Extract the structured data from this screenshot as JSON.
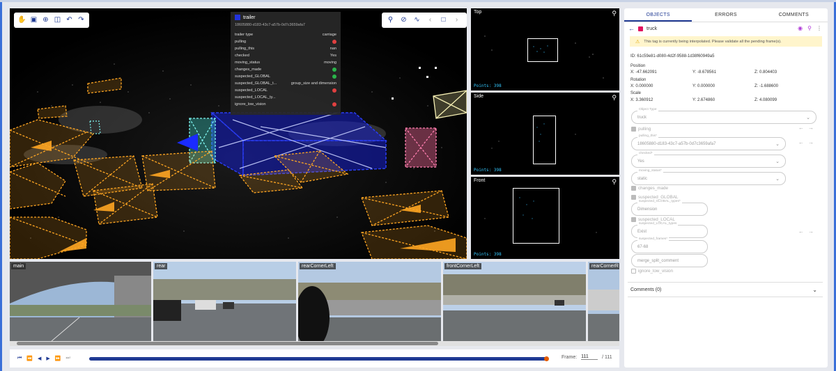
{
  "main_view": {
    "info_panel": {
      "title": "trailer",
      "uid": "18605880-d183-43c7-a57b-0d7c3659afa7",
      "rows": [
        {
          "label": "trailer type",
          "value": "carriage"
        },
        {
          "label": "pulling",
          "value": "no"
        },
        {
          "label": "pulling_this",
          "value": "nan"
        },
        {
          "label": "checked",
          "value": "Yes"
        },
        {
          "label": "moving_status",
          "value": "moving"
        },
        {
          "label": "changes_made",
          "value": "yes"
        },
        {
          "label": "suspected_GLOBAL",
          "value": "yes"
        },
        {
          "label": "suspected_GLOBAL_t...",
          "value": "group_size and dimension"
        },
        {
          "label": "suspected_LOCAL",
          "value": "no"
        },
        {
          "label": "suspected_LOCAL_ty...",
          "value": ""
        },
        {
          "label": "ignore_low_vision",
          "value": "no"
        }
      ]
    }
  },
  "side_views": [
    {
      "label": "Top",
      "points": "Points: 398"
    },
    {
      "label": "Side",
      "points": "Points: 398"
    },
    {
      "label": "Front",
      "points": "Points: 398"
    }
  ],
  "cameras": [
    "main",
    "rear",
    "rearCornerLeft",
    "frontCornerLeft",
    "rearCornerR"
  ],
  "player": {
    "frame_label": "Frame:",
    "frame_value": "111",
    "frame_total": "/ 111",
    "progress": 0.99
  },
  "panel": {
    "tabs": [
      "OBJECTS",
      "ERRORS",
      "COMMENTS"
    ],
    "active_tab": "OBJECTS",
    "object_name": "truck",
    "object_color": "#e0115f",
    "warning": "This tag is currently being interpolated. Please validate all the pending frame(s).",
    "id_line": "ID: 61c59e81-d080-4d2f-9588-1d38f60949a5",
    "position_label": "Position",
    "position": [
      "X: -47.662091",
      "Y: -8.678561",
      "Z: 0.804403"
    ],
    "rotation_label": "Rotation",
    "rotation": [
      "X: 0.000000",
      "Y: 0.000000",
      "Z: -1.688600"
    ],
    "scale_label": "Scale",
    "scale": [
      "X: 3.360912",
      "Y: 2.674860",
      "Z: 4.080099"
    ],
    "object_type_label": "Object Type",
    "object_type_value": "truck",
    "pulling_label": "pulling",
    "pulling_this_label": "pulling_this*",
    "pulling_this_value": "18605880-d183-43c7-a57b-0d7c3659afa7",
    "checked_label": "checked*",
    "checked_value": "Yes",
    "moving_status_label": "moving_status*",
    "moving_status_value": "static",
    "changes_made_label": "changes_made",
    "suspected_global_label": "suspected_GLOBAL",
    "suspected_global_types_label": "suspected_GLOBAL_types*",
    "suspected_global_types_value": "Dimension",
    "suspected_local_label": "suspected_LOCAL",
    "suspected_local_types_label": "suspected_LOCAL_types",
    "suspected_local_types_value": "Exist",
    "suspected_frames_label": "suspected_frames*",
    "suspected_frames_value": "67-68",
    "merge_split_placeholder": "merge_split_comment",
    "ignore_low_vision_label": "ignore_low_vision",
    "comments_label": "Comments (0)"
  }
}
